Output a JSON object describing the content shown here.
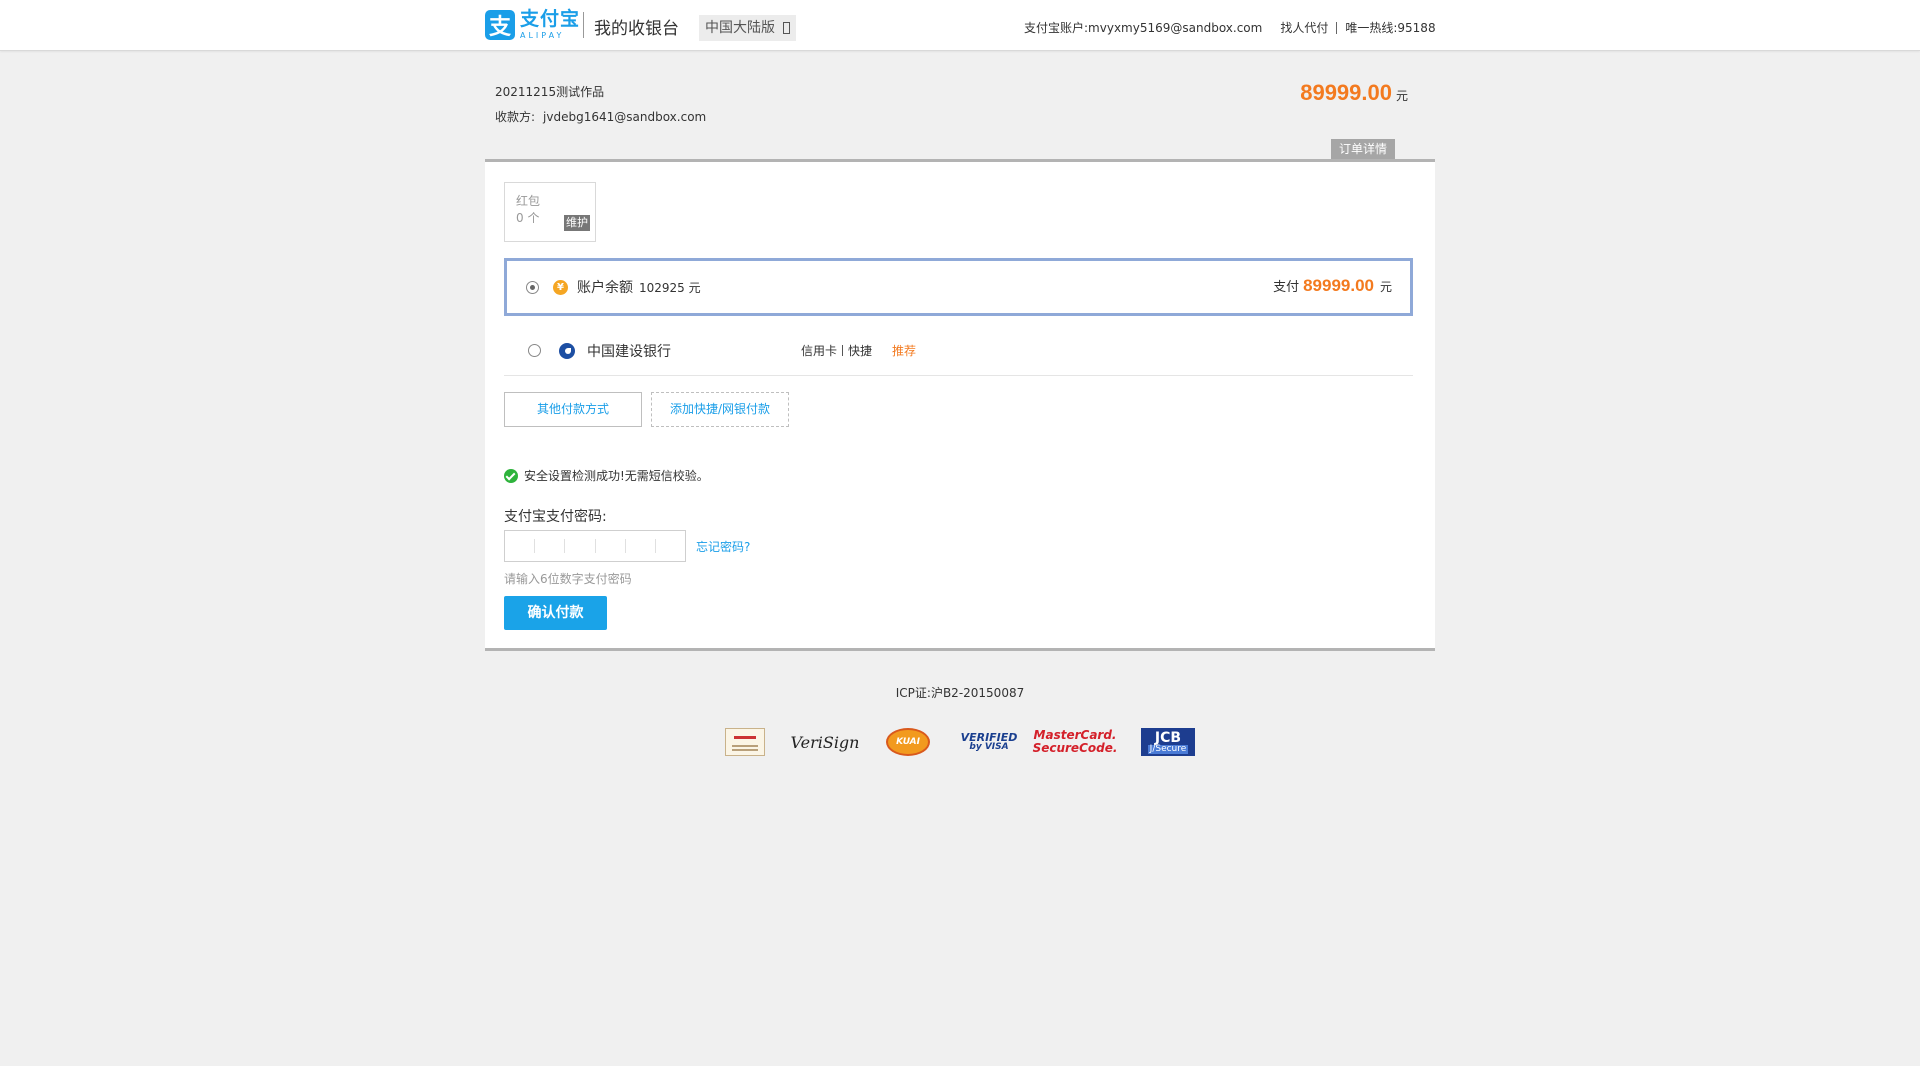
{
  "header": {
    "brand_cn": "支付宝",
    "brand_en": "ALIPAY",
    "app_title": "我的收银台",
    "region": "中国大陆版",
    "account_label": "支付宝账户:",
    "account_email": "mvyxmy5169@sandbox.com",
    "agent_pay": "找人代付",
    "hotline": "唯一热线:95188"
  },
  "order": {
    "name": "20211215测试作品",
    "payee_label": "收款方:",
    "payee_email": "jvdebg1641@sandbox.com",
    "total": "89999.00",
    "currency": "元",
    "detail_button": "订单详情"
  },
  "hongbao": {
    "label": "红包",
    "count": "0 个",
    "status": "维护"
  },
  "methods": {
    "balance": {
      "label": "账户余额",
      "value": "102925 元",
      "pay_label": "支付",
      "pay_amount": "89999.00",
      "pay_unit": "元",
      "selected": true
    },
    "bank": {
      "name": "中国建设银行",
      "tag1": "信用卡",
      "tag2": "快捷",
      "recommend": "推荐",
      "selected": false
    }
  },
  "buttons": {
    "other_methods": "其他付款方式",
    "add_method": "添加快捷/网银付款",
    "confirm": "确认付款"
  },
  "security": {
    "message": "安全设置检测成功!无需短信校验。",
    "password_label": "支付宝支付密码:",
    "forgot": "忘记密码?",
    "hint": "请输入6位数字支付密码"
  },
  "footer": {
    "icp": "ICP证:沪B2-20150087",
    "badges": {
      "verisign": "VeriSign",
      "kuaiqian": "KUAI",
      "visa_line1": "VERIFIED",
      "visa_line2": "by VISA",
      "mc_line1": "MasterCard.",
      "mc_line2": "SecureCode.",
      "jcb_line1": "JCB",
      "jcb_line2": "J/Secure"
    }
  },
  "colors": {
    "brand_blue": "#1a9ee8",
    "amount_orange": "#f37a1f",
    "selected_border": "#8fa9d8",
    "success_green": "#2eb33c"
  }
}
